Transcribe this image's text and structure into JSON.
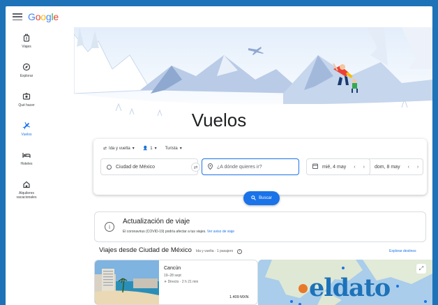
{
  "app": {
    "logo_letters": [
      {
        "ch": "G",
        "color": "#4285f4"
      },
      {
        "ch": "o",
        "color": "#ea4335"
      },
      {
        "ch": "o",
        "color": "#fbbc05"
      },
      {
        "ch": "g",
        "color": "#4285f4"
      },
      {
        "ch": "l",
        "color": "#34a853"
      },
      {
        "ch": "e",
        "color": "#ea4335"
      }
    ],
    "accent": "#1a73e8",
    "frame_color": "#1d72b8"
  },
  "sidebar": {
    "items": [
      {
        "label": "Viajes",
        "icon": "luggage-icon"
      },
      {
        "label": "Explorar",
        "icon": "explore-icon"
      },
      {
        "label": "Qué hacer",
        "icon": "camera-icon"
      },
      {
        "label": "Vuelos",
        "icon": "flight-icon",
        "active": true
      },
      {
        "label": "Hoteles",
        "icon": "bed-icon"
      },
      {
        "label": "Alquileres vacacionales",
        "icon": "house-icon"
      }
    ]
  },
  "main": {
    "title": "Vuelos"
  },
  "search": {
    "trip_type": "Ida y vuelta",
    "passengers": "1",
    "cabin_class": "Turista",
    "origin": "Ciudad de México",
    "destination_placeholder": "¿A dónde quieres ir?",
    "depart_date": "mié, 4 may",
    "return_date": "dom, 8 may",
    "search_button": "Buscar"
  },
  "update": {
    "title": "Actualización de viaje",
    "text": "El coronavirus (COVID-19) podría afectar a tus viajes.",
    "link": "Ver aviso de viaje"
  },
  "destinations": {
    "heading": "Viajes desde Ciudad de México",
    "subheading": "Ida y vuelta · 1 pasajero",
    "explore_link": "Explorar destinos",
    "cards": [
      {
        "name": "Cancún",
        "dates": "19–28 sept",
        "flight": "Directo · 2 h 21 min",
        "price": "1.409 MXN"
      }
    ]
  },
  "watermark": {
    "text": "eldato",
    "dot_color": "#e8792b"
  }
}
